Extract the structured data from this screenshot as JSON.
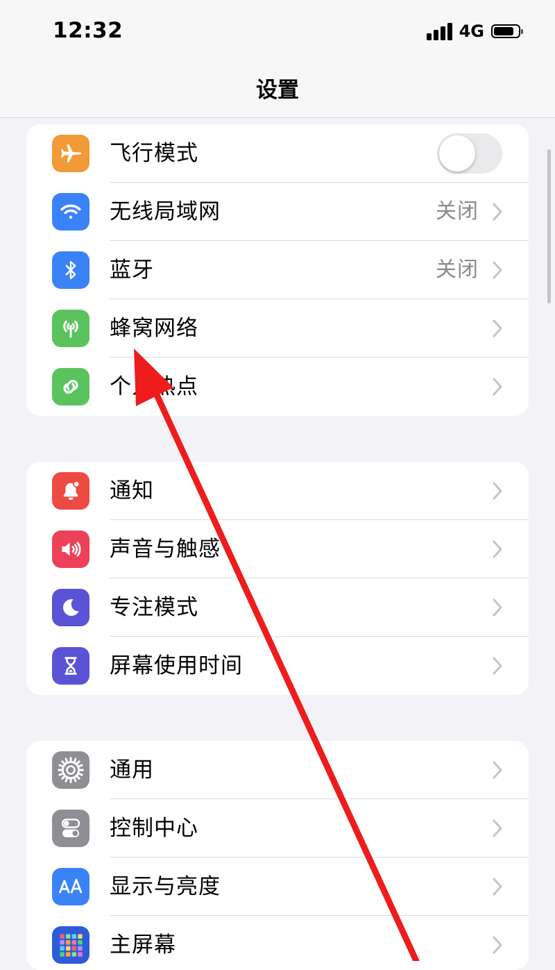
{
  "status_bar": {
    "time": "12:32",
    "network": "4G"
  },
  "nav": {
    "title": "设置"
  },
  "groups": [
    {
      "rows": [
        {
          "label": "飞行模式",
          "icon": "airplane-icon",
          "color": "#f19a37",
          "toggle": false
        },
        {
          "label": "无线局域网",
          "icon": "wifi-icon",
          "color": "#3a82f7",
          "value": "关闭"
        },
        {
          "label": "蓝牙",
          "icon": "bluetooth-icon",
          "color": "#3a82f7",
          "value": "关闭"
        },
        {
          "label": "蜂窝网络",
          "icon": "cellular-antenna-icon",
          "color": "#5ac35e"
        },
        {
          "label": "个人热点",
          "icon": "hotspot-link-icon",
          "color": "#5ac35e"
        }
      ]
    },
    {
      "rows": [
        {
          "label": "通知",
          "icon": "bell-icon",
          "color": "#ee4a44"
        },
        {
          "label": "声音与触感",
          "icon": "speaker-icon",
          "color": "#ec4158"
        },
        {
          "label": "专注模式",
          "icon": "moon-icon",
          "color": "#5b53d5"
        },
        {
          "label": "屏幕使用时间",
          "icon": "hourglass-icon",
          "color": "#5b53d5"
        }
      ]
    },
    {
      "rows": [
        {
          "label": "通用",
          "icon": "gear-icon",
          "color": "#8e8e93"
        },
        {
          "label": "控制中心",
          "icon": "toggles-icon",
          "color": "#8e8e93"
        },
        {
          "label": "显示与亮度",
          "icon": "text-size-icon",
          "color": "#3a82f7"
        },
        {
          "label": "主屏幕",
          "icon": "app-grid-icon",
          "color": "#2f5bd8"
        }
      ]
    }
  ],
  "annotation": {
    "color": "#ee1c1c"
  }
}
